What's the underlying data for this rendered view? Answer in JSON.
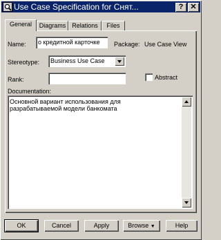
{
  "window": {
    "title": "Use Case Specification for Снят...",
    "help_btn": "?",
    "close_btn": "✕"
  },
  "tabs": [
    {
      "label": "General",
      "active": true
    },
    {
      "label": "Diagrams",
      "active": false
    },
    {
      "label": "Relations",
      "active": false
    },
    {
      "label": "Files",
      "active": false
    }
  ],
  "general": {
    "name_label": "Name:",
    "name_value": "о кредитной карточке",
    "package_label": "Package:",
    "package_value": "Use Case View",
    "stereotype_label": "Stereotype:",
    "stereotype_value": "Business Use Case",
    "rank_label": "Rank:",
    "rank_value": "",
    "abstract_label": "Abstract",
    "abstract_checked": false,
    "documentation_label": "Documentation:",
    "documentation_line1": "Основной вариант использования для",
    "documentation_line2": "разрабатываемой модели банкомата"
  },
  "buttons": {
    "ok": "OK",
    "cancel": "Cancel",
    "apply": "Apply",
    "browse": "Browse",
    "help": "Help"
  },
  "icons": {
    "title": "magnifier-icon",
    "browse_arrow": "chevron-down-icon"
  }
}
